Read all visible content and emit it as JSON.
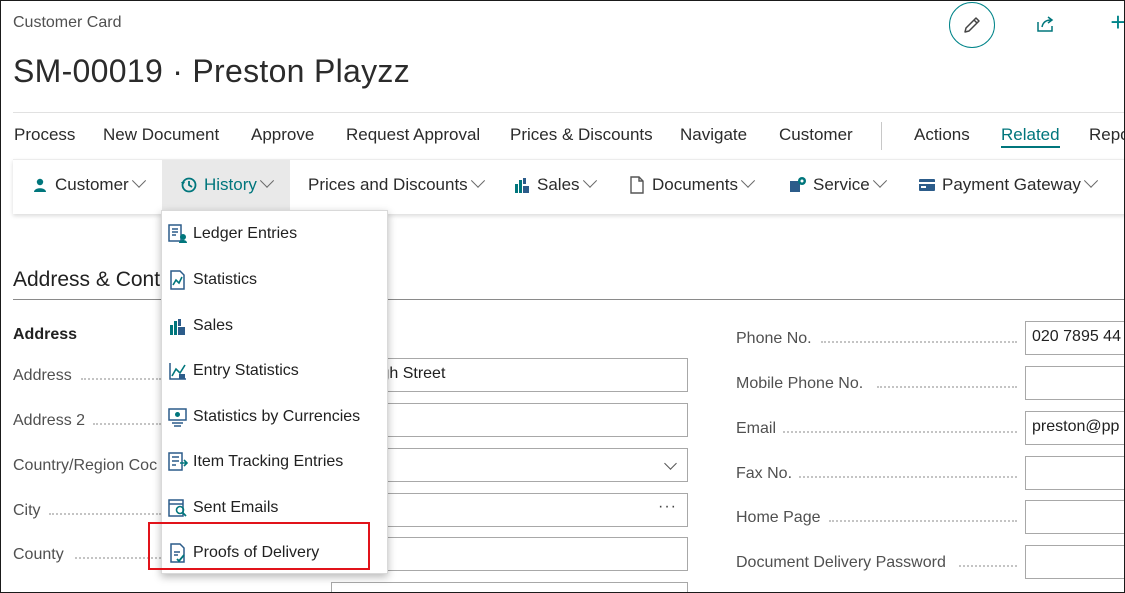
{
  "header": {
    "card_type": "Customer Card",
    "record_title": "SM-00019 · Preston Playzz",
    "edit_icon": "pencil-icon",
    "share_icon": "share-icon",
    "new_icon": "plus-icon",
    "new_glyph": "+"
  },
  "actionbar": {
    "items": [
      "Process",
      "New Document",
      "Approve",
      "Request Approval",
      "Prices & Discounts",
      "Navigate",
      "Customer",
      "Actions",
      "Related",
      "Repo"
    ],
    "active": "Related"
  },
  "subbar": {
    "items": [
      {
        "label": "Customer",
        "icon": "person-icon"
      },
      {
        "label": "History",
        "icon": "history-clock-icon"
      },
      {
        "label": "Prices and Discounts",
        "icon": ""
      },
      {
        "label": "Sales",
        "icon": "sales-chart-icon"
      },
      {
        "label": "Documents",
        "icon": "document-icon"
      },
      {
        "label": "Service",
        "icon": "service-icon"
      },
      {
        "label": "Payment Gateway",
        "icon": "card-icon"
      }
    ],
    "open": "History"
  },
  "history_menu": {
    "items": [
      {
        "label": "Ledger Entries",
        "icon": "ledger-icon"
      },
      {
        "label": "Statistics",
        "icon": "statistics-icon"
      },
      {
        "label": "Sales",
        "icon": "sales-chart-icon"
      },
      {
        "label": "Entry Statistics",
        "icon": "entry-statistics-icon"
      },
      {
        "label": "Statistics by Currencies",
        "icon": "currency-icon"
      },
      {
        "label": "Item Tracking Entries",
        "icon": "item-tracking-icon"
      },
      {
        "label": "Sent Emails",
        "icon": "sent-emails-icon"
      },
      {
        "label": "Proofs of Delivery",
        "icon": "proof-delivery-icon"
      }
    ],
    "highlighted": "Proofs of Delivery"
  },
  "section": {
    "title": "Address & Cont",
    "group": "Address"
  },
  "fields_left": [
    {
      "label": "Address",
      "value": "n High Street"
    },
    {
      "label": "Address 2",
      "value": ""
    },
    {
      "label": "Country/Region Coc",
      "value": ""
    },
    {
      "label": "City",
      "value": "",
      "ellipsis": "···"
    },
    {
      "label": "County",
      "value": ""
    }
  ],
  "fields_right": [
    {
      "label": "Phone No.",
      "value": "020 7895 44"
    },
    {
      "label": "Mobile Phone No.",
      "value": ""
    },
    {
      "label": "Email",
      "value": "preston@pp"
    },
    {
      "label": "Fax No.",
      "value": ""
    },
    {
      "label": "Home Page",
      "value": ""
    },
    {
      "label": "Document Delivery Password",
      "value": ""
    }
  ],
  "colors": {
    "accent": "#00767c",
    "highlight": "#e1131a"
  }
}
